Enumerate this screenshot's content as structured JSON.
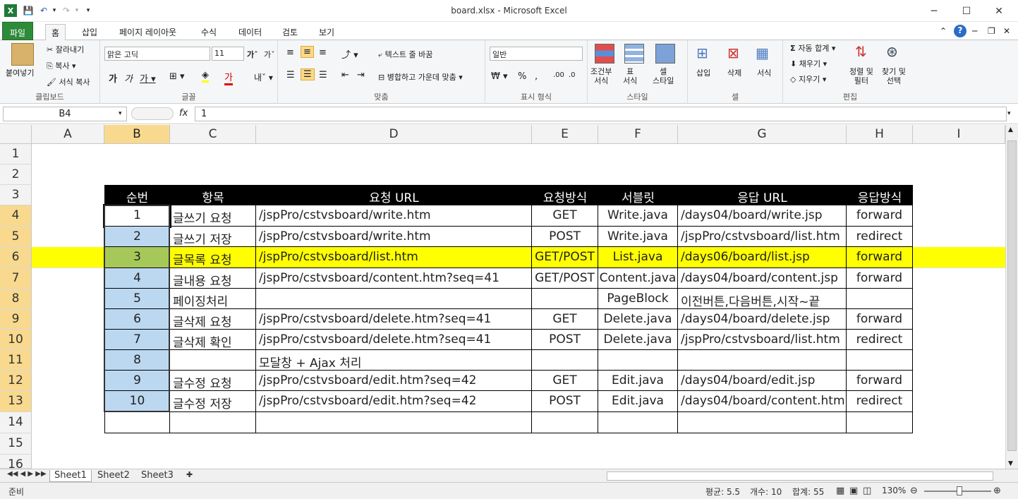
{
  "window": {
    "title": "board.xlsx - Microsoft Excel",
    "minimize": "─",
    "maximize": "☐",
    "close": "✕"
  },
  "ribbon_tabs": [
    "파일",
    "홈",
    "삽입",
    "페이지 레이아웃",
    "수식",
    "데이터",
    "검토",
    "보기"
  ],
  "ribbon": {
    "clipboard": {
      "paste": "붙여넣기",
      "cut": "잘라내기",
      "copy": "복사",
      "format_copy": "서식 복사",
      "label": "클립보드"
    },
    "font": {
      "name": "맑은 고딕",
      "size": "11",
      "label": "글꼴"
    },
    "align": {
      "wrap": "텍스트 줄 바꿈",
      "merge": "병합하고 가운데 맞춤",
      "label": "맞춤"
    },
    "number": {
      "format": "일반",
      "label": "표시 형식"
    },
    "styles": {
      "cond": "조건부\n서식",
      "table": "표\n서식",
      "cell": "셀\n스타일",
      "label": "스타일"
    },
    "cells": {
      "insert": "삽입",
      "delete": "삭제",
      "format": "서식",
      "label": "셀"
    },
    "edit": {
      "autosum": "자동 합계",
      "fill": "채우기",
      "clear": "지우기",
      "sort": "정렬 및\n필터",
      "find": "찾기 및\n선택",
      "label": "편집"
    }
  },
  "formula": {
    "namebox": "B4",
    "fx": "fx",
    "value": "1"
  },
  "columns": [
    "A",
    "B",
    "C",
    "D",
    "E",
    "F",
    "G",
    "H",
    "I"
  ],
  "rows": [
    "1",
    "2",
    "3",
    "4",
    "5",
    "6",
    "7",
    "8",
    "9",
    "10",
    "11",
    "12",
    "13",
    "14",
    "15",
    "16"
  ],
  "table": {
    "headers": [
      "순번",
      "항목",
      "요청 URL",
      "요청방식",
      "서블릿",
      "응답 URL",
      "응답방식"
    ],
    "rows": [
      [
        "1",
        "글쓰기 요청",
        "/jspPro/cstvsboard/write.htm",
        "GET",
        "Write.java",
        "/days04/board/write.jsp",
        "forward"
      ],
      [
        "2",
        "글쓰기 저장",
        "/jspPro/cstvsboard/write.htm",
        "POST",
        "Write.java",
        "/jspPro/cstvsboard/list.htm",
        "redirect"
      ],
      [
        "3",
        "글목록 요청",
        "/jspPro/cstvsboard/list.htm",
        "GET/POST",
        "List.java",
        "/days06/board/list.jsp",
        "forward"
      ],
      [
        "4",
        "글내용 요청",
        "/jspPro/cstvsboard/content.htm?seq=41",
        "GET/POST",
        "Content.java",
        "/days04/board/content.jsp",
        "forward"
      ],
      [
        "5",
        "페이징처리",
        "",
        "",
        "PageBlock",
        "이전버튼,다음버튼,시작~끝",
        ""
      ],
      [
        "6",
        "글삭제 요청",
        "/jspPro/cstvsboard/delete.htm?seq=41",
        "GET",
        "Delete.java",
        "/days04/board/delete.jsp",
        "forward"
      ],
      [
        "7",
        "글삭제 확인",
        "/jspPro/cstvsboard/delete.htm?seq=41",
        "POST",
        "Delete.java",
        "/jspPro/cstvsboard/list.htm",
        "redirect"
      ],
      [
        "8",
        "",
        "모달창 + Ajax 처리",
        "",
        "",
        "",
        ""
      ],
      [
        "9",
        "글수정 요청",
        "/jspPro/cstvsboard/edit.htm?seq=42",
        "GET",
        "Edit.java",
        "/days04/board/edit.jsp",
        "forward"
      ],
      [
        "10",
        "글수정 저장",
        "/jspPro/cstvsboard/edit.htm?seq=42",
        "POST",
        "Edit.java",
        "/days04/board/content.htm",
        "redirect"
      ]
    ]
  },
  "sheets": [
    "Sheet1",
    "Sheet2",
    "Sheet3"
  ],
  "status": {
    "ready": "준비",
    "average": "평균: 5.5",
    "count": "개수: 10",
    "sum": "합계: 55",
    "zoom": "130%"
  },
  "colors": {
    "header_bg": "#000000",
    "highlight_row": "#ffff00",
    "selection": "#bcd8f1",
    "file_tab": "#2e8b3a"
  }
}
